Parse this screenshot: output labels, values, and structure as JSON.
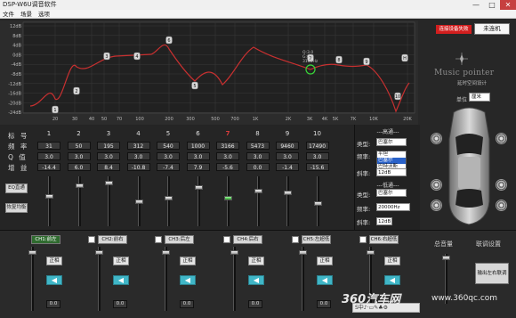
{
  "window": {
    "title": "DSP-W6U调音软件",
    "min": "—",
    "max": "□",
    "close": "✕"
  },
  "menu": [
    "文件",
    "场景",
    "选项"
  ],
  "eq": {
    "y_labels": [
      "12dB",
      "8dB",
      "4dB",
      "0dB",
      "-4dB",
      "-8dB",
      "-12dB",
      "-16dB",
      "-20dB",
      "-24dB"
    ],
    "x_labels": [
      "20",
      "30",
      "40",
      "50",
      "70",
      "100",
      "200",
      "300",
      "500",
      "700",
      "1K",
      "2K",
      "3K",
      "4K",
      "5K",
      "7K",
      "10K",
      "20K"
    ],
    "annotation": [
      "Q:3.0",
      "G:0.0",
      "3166Hz"
    ],
    "markers": [
      "1",
      "2",
      "3",
      "4",
      "5",
      "6",
      "7",
      "8",
      "9",
      "10",
      "H"
    ]
  },
  "right": {
    "status_label": "连接设备失败",
    "status_button": "未连机",
    "brand": "Music pointer",
    "brand_sub": "延时空间设计",
    "unit_label": "单位",
    "unit_value": "厘米"
  },
  "table": {
    "row_labels": [
      "标 号",
      "频 率",
      "Q 值",
      "增 益"
    ],
    "columns": [
      {
        "num": "1",
        "freq": "31",
        "q": "3.0",
        "gain": "-14.4"
      },
      {
        "num": "2",
        "freq": "50",
        "q": "3.0",
        "gain": "6.0"
      },
      {
        "num": "3",
        "freq": "195",
        "q": "3.0",
        "gain": "8.4"
      },
      {
        "num": "4",
        "freq": "312",
        "q": "3.0",
        "gain": "-10.8"
      },
      {
        "num": "5",
        "freq": "540",
        "q": "3.0",
        "gain": "-7.4"
      },
      {
        "num": "6",
        "freq": "1000",
        "q": "3.0",
        "gain": "7.9"
      },
      {
        "num": "7",
        "freq": "3166",
        "q": "3.0",
        "gain": "-5.6"
      },
      {
        "num": "8",
        "freq": "5473",
        "q": "3.0",
        "gain": "0.0"
      },
      {
        "num": "9",
        "freq": "9460",
        "q": "3.0",
        "gain": "-1.4"
      },
      {
        "num": "10",
        "freq": "17490",
        "q": "3.0",
        "gain": "-15.6"
      }
    ],
    "btn_eq_bypass": "EQ直通",
    "btn_eq_reset": "恢复均衡"
  },
  "filters": {
    "high": "---高通---",
    "low": "---低通---",
    "type_label": "类型:",
    "freq_label": "频率:",
    "slope_label": "斜率:",
    "high_type": "巴塞尔",
    "high_dropdown": [
      "平坦",
      "巴塞尔",
      "巴特沃斯"
    ],
    "high_slope": "12dB",
    "low_type": "巴塞尔",
    "low_freq": "20000Hz",
    "low_slope": "12dB"
  },
  "channels": [
    {
      "label": "CH1:前左",
      "value": "0.0"
    },
    {
      "label": "CH2:前右",
      "value": "0.0"
    },
    {
      "label": "CH3:后左",
      "value": "0.0"
    },
    {
      "label": "CH4:后右",
      "value": "0.0"
    },
    {
      "label": "CH5:左超低",
      "value": "0.0"
    },
    {
      "label": "CH6:右超低",
      "value": "0.0"
    }
  ],
  "channel_phase": "正相",
  "master": {
    "title": "总音量",
    "link_title": "联调设置",
    "link_button": "输出左右联调",
    "value": "0.0"
  },
  "watermark": {
    "brand": "360汽车网",
    "url": "www.360qc.com"
  },
  "ime_tray": "S中♪·▭✎♣⚙"
}
